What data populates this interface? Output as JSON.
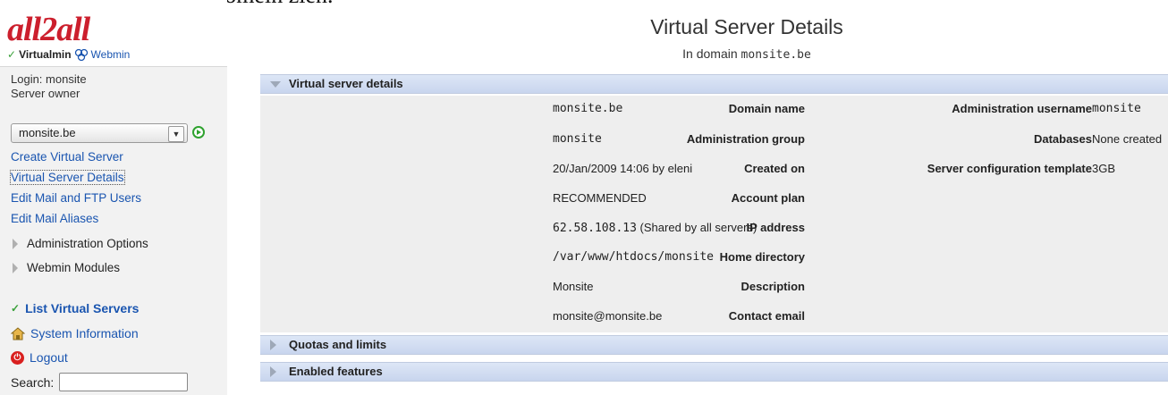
{
  "top_fragment": "gegevens over uw  domein zien.",
  "brand": {
    "logo_text": "all2all",
    "virtualmin_label": "Virtualmin",
    "webmin_label": "Webmin"
  },
  "sidebar": {
    "login_line": "Login: monsite",
    "role_line": "Server owner",
    "domain_select_value": "monsite.be",
    "links": [
      "Create Virtual Server",
      "Virtual Server Details",
      "Edit Mail and FTP Users",
      "Edit Mail Aliases"
    ],
    "categories": [
      "Administration Options",
      "Webmin Modules"
    ],
    "list_virtual_servers": "List Virtual Servers",
    "system_information": "System Information",
    "logout": "Logout",
    "search_label": "Search:",
    "search_value": ""
  },
  "main": {
    "title": "Virtual Server Details",
    "subtitle_prefix": "In domain",
    "subtitle_domain": "monsite.be",
    "section_details": "Virtual server details",
    "section_quotas": "Quotas and limits",
    "section_features": "Enabled features",
    "fields_left": [
      {
        "label": "Domain name",
        "value": "monsite.be"
      },
      {
        "label": "Administration group",
        "value": "monsite"
      },
      {
        "label": "Created on",
        "value": "20/Jan/2009 14:06 by eleni"
      },
      {
        "label": "Account plan",
        "value": "RECOMMENDED"
      },
      {
        "label": "IP address",
        "value": "62.58.108.13",
        "note": "(Shared by all servers)"
      },
      {
        "label": "Home directory",
        "value": "/var/www/htdocs/monsite"
      },
      {
        "label": "Description",
        "value": "Monsite"
      },
      {
        "label": "Contact email",
        "value": "monsite@monsite.be"
      }
    ],
    "fields_right": [
      {
        "label": "Administration username",
        "value": "monsite"
      },
      {
        "label": "Databases",
        "value": "None created"
      },
      {
        "label": "Server configuration template",
        "value": "3GB"
      }
    ]
  },
  "colors": {
    "logo_red": "#cc1f2d",
    "link_blue": "#1a55b0",
    "section_header_blue": "#c8d5ee",
    "panel_gray": "#eeeeee",
    "go_green": "#2fa22f",
    "logout_red": "#d9201f"
  },
  "icons": {
    "webmin": "webmin-logo-icon",
    "home": "home-icon",
    "logout": "power-icon",
    "go": "go-arrow-icon"
  }
}
